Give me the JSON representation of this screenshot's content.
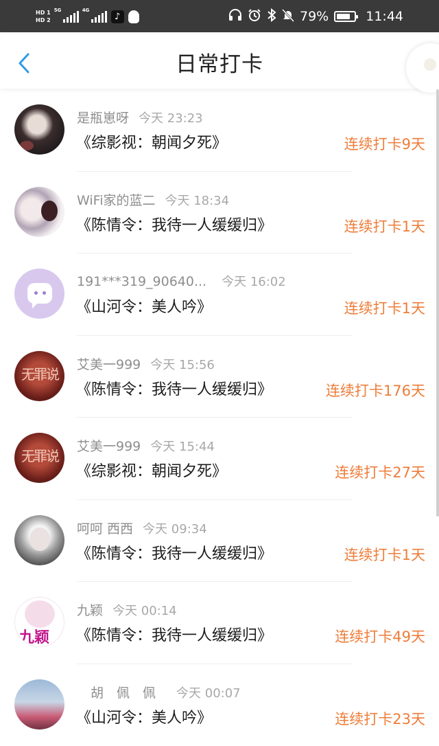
{
  "status_bar": {
    "hd1": "HD 1",
    "hd2": "HD 2",
    "net1": "5G",
    "net2": "4G",
    "battery_percent": "79%",
    "battery_level": 0.79,
    "time": "11:44",
    "icons": [
      "headphones-icon",
      "alarm-icon",
      "bluetooth-icon",
      "mute-icon",
      "battery-icon",
      "tiktok-icon",
      "qq-icon"
    ]
  },
  "header": {
    "title": "日常打卡",
    "back_icon": "chevron-left-icon",
    "accent_color": "#2f9ae8"
  },
  "entries": [
    {
      "user": "是瓶崽呀",
      "time": "今天 23:23",
      "book": "《综影视：朝闻夕死》",
      "streak": "连续打卡9天"
    },
    {
      "user": "WiFi家的蓝二",
      "time": "今天 18:34",
      "book": "《陈情令：我待一人缓缓归》",
      "streak": "连续打卡1天"
    },
    {
      "user": "191***319_90640...",
      "time": "今天 16:02",
      "book": "《山河令：美人吟》",
      "streak": "连续打卡1天"
    },
    {
      "user": "艾美一999",
      "time": "今天 15:56",
      "book": "《陈情令：我待一人缓缓归》",
      "streak": "连续打卡176天"
    },
    {
      "user": "艾美一999",
      "time": "今天 15:44",
      "book": "《综影视：朝闻夕死》",
      "streak": "连续打卡27天"
    },
    {
      "user": "呵呵 西西",
      "time": "今天 09:34",
      "book": "《陈情令：我待一人缓缓归》",
      "streak": "连续打卡1天"
    },
    {
      "user": "九颖",
      "time": "今天 00:14",
      "book": "《陈情令：我待一人缓缓归》",
      "streak": "连续打卡49天"
    },
    {
      "user": "胡　佩　佩",
      "time": "今天 00:07",
      "book": "《山河令：美人吟》",
      "streak": "连续打卡23天"
    }
  ],
  "avatar_texts": {
    "seal": "无罪说",
    "jiuying": "九颖"
  },
  "colors": {
    "streak": "#ee7d3a",
    "status_bar_bg": "#3a3a3a",
    "username": "#8e8e8e"
  }
}
